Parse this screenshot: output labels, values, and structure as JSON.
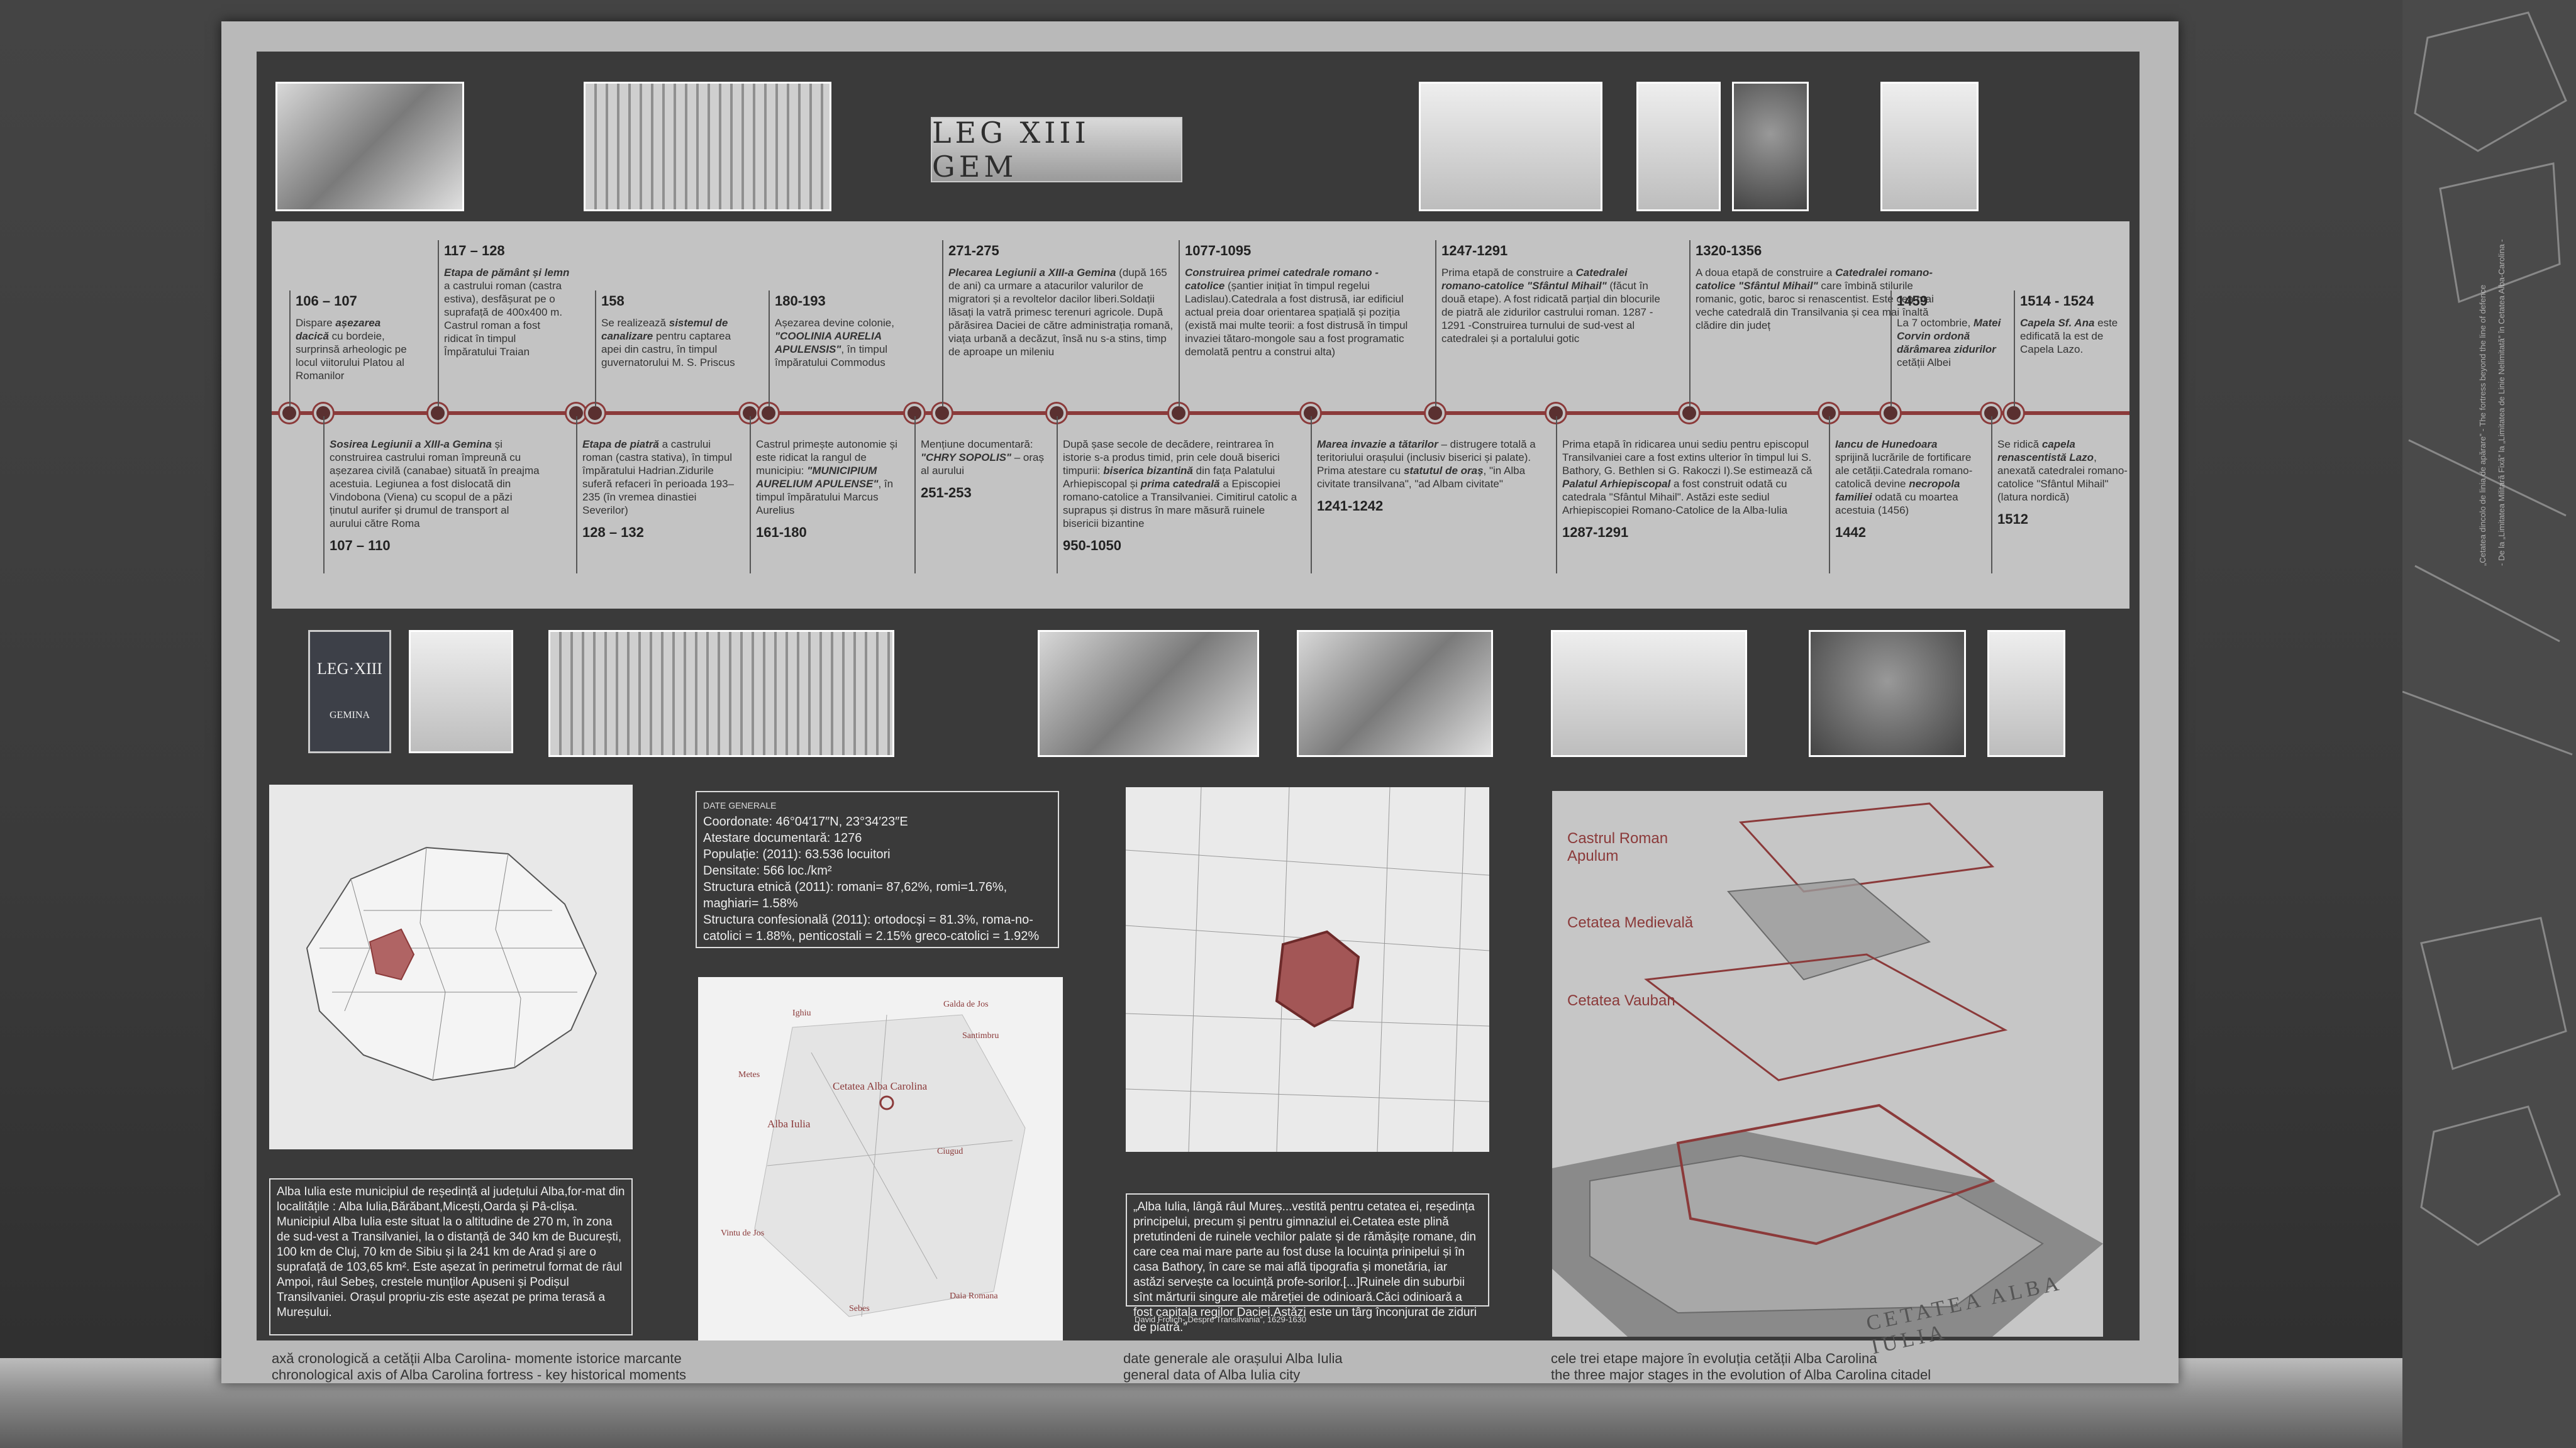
{
  "sidebar": {
    "line1": "„Cetatea dincolo de linia de apărare” - The fortress beyond the line of defence",
    "line2": "- De la „Limitatea Militară Fixă” la „Limitatea de Linie Nelimitată” în Cetatea Alba-Carolina -"
  },
  "top_inscription": "LEG XIII GEM",
  "leg_badge": {
    "top": "LEG·XIII",
    "bottom": "GEMINA"
  },
  "timeline": {
    "above": [
      {
        "year": "106 – 107",
        "text_html": "Dispare <b>așezarea dacică</b> cu bordeie, surprinsă arheologic pe locul viitorului Platou al Romanilor"
      },
      {
        "year": "117 – 128",
        "text_html": "<b>Etapa de pământ și lemn</b> a castrului roman (castra estiva), desfășurat pe o suprafață de 400x400 m. Castrul roman a fost ridicat în timpul Împăratului Traian"
      },
      {
        "year": "158",
        "text_html": "Se realizează <b>sistemul de canalizare</b> pentru captarea apei din castru, în timpul guvernatorului M. S. Priscus"
      },
      {
        "year": "180-193",
        "text_html": "Așezarea devine colonie, <b>\"COOLINIA AURELIA APULENSIS\"</b>, în timpul împăratului Commodus"
      },
      {
        "year": "271-275",
        "text_html": "<b>Plecarea Legiunii a XIII-a Gemina</b> (după 165 de ani) ca urmare a atacurilor valurilor de migratori și a revoltelor dacilor liberi.Soldații lăsați la vatră primesc terenuri agricole. După părăsirea Daciei de către administrația romană, viața urbană a decăzut, însă nu s-a stins, timp de aproape un mileniu"
      },
      {
        "year": "1077-1095",
        "text_html": "<b>Construirea primei catedrale romano -catolice</b> (șantier inițiat în timpul regelui Ladislau).Catedrala a fost distrusă, iar edificiul actual preia doar orientarea spațială și poziția (există mai multe teorii: a fost distrusă în timpul invaziei tătaro-mongole sau a fost programatic demolată pentru a construi alta)"
      },
      {
        "year": "1247-1291",
        "text_html": "Prima etapă de construire a <b>Catedralei romano-catolice \"Sfântul Mihail\"</b> (făcut în două etape). A fost ridicată parțial din blocurile de piatră ale zidurilor castrului roman. 1287 - 1291 -Construirea turnului de sud-vest al catedralei și a portalului gotic"
      },
      {
        "year": "1320-1356",
        "text_html": "A doua etapă de construire a <b>Catedralei romano-catolice \"Sfântul Mihail\"</b> care îmbină stilurile romanic, gotic, baroc si renascentist. Este cea mai veche catedrală din Transilvania și cea mai înaltă clădire din județ"
      },
      {
        "year": "1459",
        "text_html": "La 7 octombrie, <b>Matei Corvin ordonă dărâmarea zidurilor</b> cetății Albei"
      },
      {
        "year": "1514 - 1524",
        "text_html": "<b>Capela Sf. Ana</b> este edificată la est de Capela Lazo."
      }
    ],
    "below": [
      {
        "year": "107 – 110",
        "text_html": "<b>Sosirea Legiunii a XIII-a Gemina</b> și construirea castrului roman împreună cu așezarea civilă (canabae) situată în preajma acestuia. Legiunea a fost dislocată din Vindobona (Viena) cu scopul de a păzi ținutul aurifer și drumul de transport al aurului către Roma"
      },
      {
        "year": "128 – 132",
        "text_html": "<b>Etapa de piatră</b> a castrului roman (castra stativa), în timpul împăratului Hadrian.Zidurile suferă refaceri în perioada 193–235 (în vremea dinastiei Severilor)"
      },
      {
        "year": "161-180",
        "text_html": "Castrul primește autonomie și este ridicat la rangul de municipiu: <b>\"MUNICIPIUM AURELIUM APULENSE\"</b>, în timpul împăratului Marcus Aurelius"
      },
      {
        "year": "251-253",
        "text_html": "Mențiune documentară: <b>\"CHRY SOPOLIS\"</b> – oraș al aurului"
      },
      {
        "year": "950-1050",
        "text_html": "După șase secole de decădere, reintrarea în istorie s-a produs timid, prin cele două biserici timpurii: <b>biserica bizantină</b> din fața Palatului Arhiepiscopal și <b>prima catedrală</b> a Episcopiei romano-catolice a Transilvaniei. Cimitirul catolic a suprapus și distrus în mare măsură ruinele bisericii bizantine"
      },
      {
        "year": "1241-1242",
        "text_html": "<b>Marea invazie a tătarilor</b> – distrugere totală a teritoriului orașului (inclusiv biserici și palate). Prima atestare cu <b>statutul de oraș</b>, \"in Alba civitate transilvana\", \"ad Albam civitate\""
      },
      {
        "year": "1287-1291",
        "text_html": "Prima etapă în ridicarea unui sediu pentru episcopul Transilvaniei care a fost extins ulterior în timpul lui S. Bathory, G. Bethlen si G. Rakoczi I).Se estimează că <b>Palatul Arhiepiscopal</b> a fost construit odată cu catedrala \"Sfântul Mihail\". Astăzi este sediul Arhiepiscopiei Romano-Catolice de la Alba-Iulia"
      },
      {
        "year": "1442",
        "text_html": "<b>Iancu de Hunedoara</b> sprijină lucrările de fortificare ale cetății.Catedrala romano-catolică devine <b>necropola familiei</b> odată cu moartea acestuia (1456)"
      },
      {
        "year": "1512",
        "text_html": "Se ridică <b>capela renascentistă Lazo</b>, anexată catedralei romano-catolice \"Sfântul Mihail\"(latura nordică)"
      }
    ]
  },
  "general_data": {
    "title": "DATE GENERALE",
    "lines": [
      "Coordonate: 46°04′17″N, 23°34′23″E",
      "Atestare documentară: 1276",
      "Populație: (2011): 63.536 locuitori",
      "Densitate: 566 loc./km²",
      "Structura etnică (2011): romani= 87,62%, romi=1.76%, maghiari= 1.58%",
      "Structura confesională (2011): ortodocși = 81.3%, roma-no-catolici = 1.88%, penticostali = 2.15% greco-catolici = 1.92%"
    ]
  },
  "description": "Alba Iulia este municipiul de reședință al județului Alba,for-mat din localitățile : Alba Iulia,Bărăbant,Micești,Oarda și Pâ-clișa. Municipiul Alba Iulia este situat la o altitudine de 270 m, în zona de sud-vest a Transilvaniei, la o distanță de 340 km de București, 100 km de Cluj, 70 km de Sibiu și la 241 km de Arad și are o suprafață de 103,65 km². Este așezat în perimetrul format de râul Ampoi, râul Sebeș, crestele munților Apuseni și Podișul Transilvaniei. Orașul propriu-zis este așezat pe prima terasă a Mureșului.",
  "quote": {
    "text": "„Alba Iulia, lângă râul Mureș...vestită pentru cetatea ei, reședința principelui, precum și pentru gimnaziul ei.Cetatea este plină pretutindeni de ruinele vechilor palate și de rămășițe romane, din care cea mai mare parte au fost duse la locuința prinipelui și în casa Bathory, în care se mai află tipografia și monetăria, iar astăzi servește ca locuință profe-sorilor.[...]Ruinele din suburbii sînt mărturii singure ale măreției de odinioară.Căci odinioară a fost capitala regilor Daciei.Astăzi este un târg înconjurat de ziduri de piatră.”",
    "source": "David Frolich-„Despre Transilvania”, 1629-1630"
  },
  "local_map_labels": [
    "Ighiu",
    "Galda de Jos",
    "Santimbru",
    "Metes",
    "Cetatea Alba Carolina",
    "Alba Iulia",
    "Ciugud",
    "Vintu de Jos",
    "Daia Romana",
    "Sebes"
  ],
  "layers": [
    "Castrul Roman Apulum",
    "Cetatea Medievală",
    "Cetatea Vauban"
  ],
  "model_text": "CETATEA ALBA IULIA",
  "captions": [
    {
      "ro": "axă cronologică a cetății Alba Carolina- momente istorice marcante",
      "en": "chronological axis of Alba Carolina fortress - key historical moments"
    },
    {
      "ro": "date generale ale orașului Alba Iulia",
      "en": "general data of Alba Iulia city"
    },
    {
      "ro": "cele trei etape majore în evoluția cetății Alba Carolina",
      "en": "the three major stages in the evolution of Alba Carolina citadel"
    }
  ],
  "colors": {
    "accent": "#8b3a3a",
    "panel": "#3a3a3a",
    "band": "#c3c3c3"
  }
}
